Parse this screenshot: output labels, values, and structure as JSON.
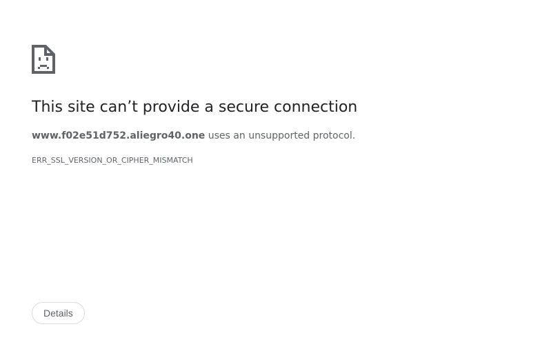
{
  "error_icon": "sad-document-icon",
  "title": "This site can’t provide a secure connection",
  "description": {
    "host": "www.f02e51d752.aliegro40.one",
    "message": " uses an unsupported protocol."
  },
  "error_code": "ERR_SSL_VERSION_OR_CIPHER_MISMATCH",
  "details_button": "Details"
}
